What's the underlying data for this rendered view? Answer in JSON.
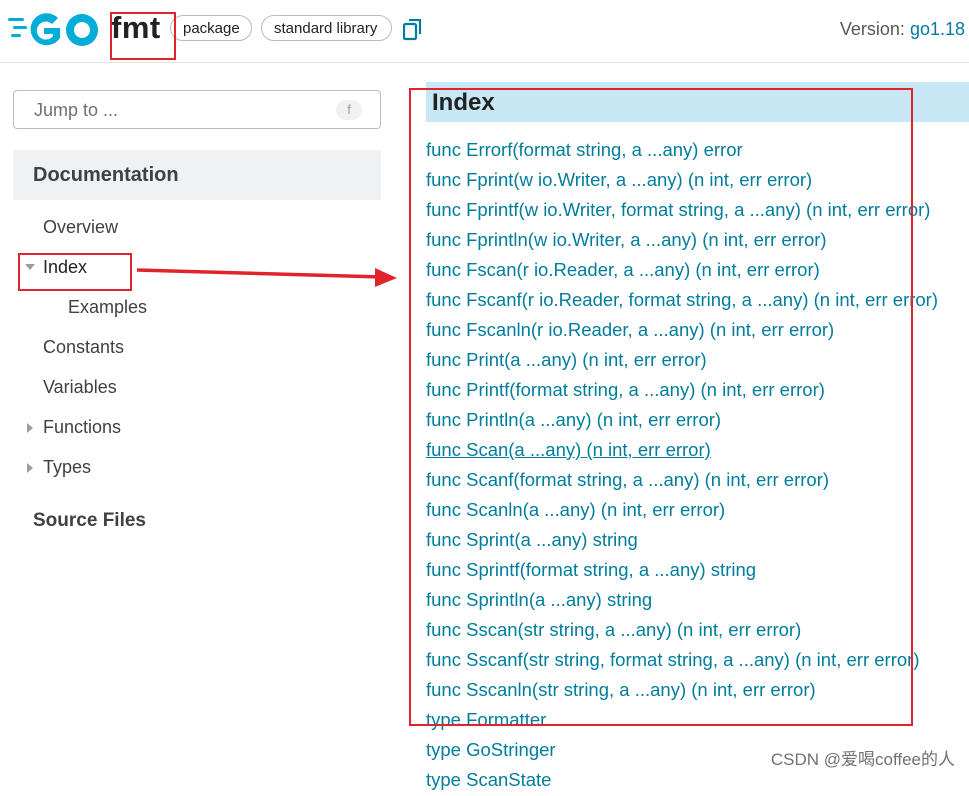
{
  "header": {
    "package_name": "fmt",
    "chips": [
      "package",
      "standard library"
    ],
    "version_label": "Version: ",
    "version_value": "go1.18"
  },
  "sidebar": {
    "jump_placeholder": "Jump to ...",
    "jump_shortcut": "f",
    "section_title": "Documentation",
    "items": [
      {
        "label": "Overview"
      },
      {
        "label": "Index"
      },
      {
        "label": "Examples"
      },
      {
        "label": "Constants"
      },
      {
        "label": "Variables"
      },
      {
        "label": "Functions"
      },
      {
        "label": "Types"
      }
    ],
    "source_files": "Source Files"
  },
  "index": {
    "title": "Index",
    "entries": [
      "func Errorf(format string, a ...any) error",
      "func Fprint(w io.Writer, a ...any) (n int, err error)",
      "func Fprintf(w io.Writer, format string, a ...any) (n int, err error)",
      "func Fprintln(w io.Writer, a ...any) (n int, err error)",
      "func Fscan(r io.Reader, a ...any) (n int, err error)",
      "func Fscanf(r io.Reader, format string, a ...any) (n int, err error)",
      "func Fscanln(r io.Reader, a ...any) (n int, err error)",
      "func Print(a ...any) (n int, err error)",
      "func Printf(format string, a ...any) (n int, err error)",
      "func Println(a ...any) (n int, err error)",
      "func Scan(a ...any) (n int, err error)",
      "func Scanf(format string, a ...any) (n int, err error)",
      "func Scanln(a ...any) (n int, err error)",
      "func Sprint(a ...any) string",
      "func Sprintf(format string, a ...any) string",
      "func Sprintln(a ...any) string",
      "func Sscan(str string, a ...any) (n int, err error)",
      "func Sscanf(str string, format string, a ...any) (n int, err error)",
      "func Sscanln(str string, a ...any) (n int, err error)",
      "type Formatter",
      "type GoStringer",
      "type ScanState"
    ]
  },
  "watermark": "CSDN @爱喝coffee的人",
  "colors": {
    "link": "#007d9c",
    "logo": "#00add8",
    "annotation": "#e0242b",
    "index_header_bg": "#c6e7f3"
  }
}
